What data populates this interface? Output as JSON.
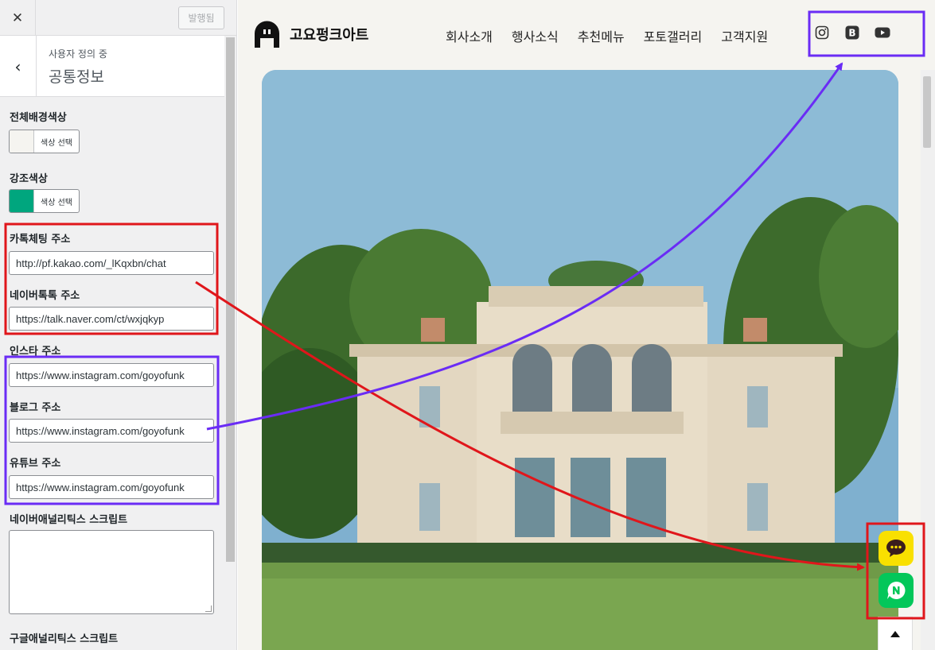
{
  "panel": {
    "close_icon": "close-icon",
    "publish_label": "발행됨",
    "back_icon": "chevron-left-icon",
    "breadcrumb": "사용자 정의 중",
    "section_title": "공통정보",
    "fields": {
      "bg_color": {
        "label": "전체배경색상",
        "button": "색상 선택",
        "swatch": "#f5f4f0"
      },
      "accent_color": {
        "label": "강조색상",
        "button": "색상 선택",
        "swatch": "#00a67e"
      },
      "kakao": {
        "label": "카톡체팅 주소",
        "value": "http://pf.kakao.com/_lKqxbn/chat"
      },
      "naver_talk": {
        "label": "네이버톡톡 주소",
        "value": "https://talk.naver.com/ct/wxjqkyp"
      },
      "instagram": {
        "label": "인스타 주소",
        "value": "https://www.instagram.com/goyofunk"
      },
      "blog": {
        "label": "블로그 주소",
        "value": "https://www.instagram.com/goyofunk"
      },
      "youtube": {
        "label": "유튜브 주소",
        "value": "https://www.instagram.com/goyofunk"
      },
      "naver_analytics": {
        "label": "네이버애널리틱스 스크립트",
        "value": ""
      },
      "google_analytics": {
        "label": "구글애널리틱스 스크립트"
      }
    }
  },
  "preview": {
    "site_title": "고요펑크아트",
    "nav": [
      "회사소개",
      "행사소식",
      "추천메뉴",
      "포토갤러리",
      "고객지원"
    ],
    "social_icons": [
      "instagram-icon",
      "blog-icon",
      "youtube-icon"
    ],
    "floating": [
      "kakao-chat-icon",
      "naver-talk-icon",
      "scroll-top-icon"
    ]
  },
  "colors": {
    "annotation_red": "#e0161b",
    "annotation_purple": "#6a2cf5",
    "kakao_yellow": "#f9e000",
    "naver_green": "#03c75a"
  }
}
